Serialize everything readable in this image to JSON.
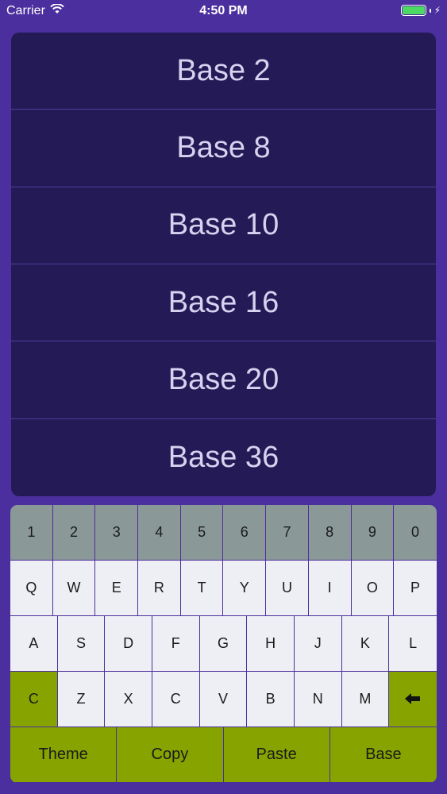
{
  "status_bar": {
    "carrier": "Carrier",
    "time": "4:50 PM",
    "wifi_icon": "wifi-icon",
    "battery_icon": "battery-icon",
    "charging_icon": "charging-bolt-icon"
  },
  "bases": [
    {
      "label": "Base 2"
    },
    {
      "label": "Base 8"
    },
    {
      "label": "Base 10"
    },
    {
      "label": "Base 16"
    },
    {
      "label": "Base 20"
    },
    {
      "label": "Base 36"
    }
  ],
  "keyboard": {
    "number_row": [
      "1",
      "2",
      "3",
      "4",
      "5",
      "6",
      "7",
      "8",
      "9",
      "0"
    ],
    "row_qwerty": [
      "Q",
      "W",
      "E",
      "R",
      "T",
      "Y",
      "U",
      "I",
      "O",
      "P"
    ],
    "row_asdf": [
      "A",
      "S",
      "D",
      "F",
      "G",
      "H",
      "J",
      "K",
      "L"
    ],
    "row_zxcv": {
      "clear": "C",
      "letters": [
        "Z",
        "X",
        "C",
        "V",
        "B",
        "N",
        "M"
      ],
      "backspace_icon": "backspace-arrow-icon"
    },
    "function_row": [
      "Theme",
      "Copy",
      "Paste",
      "Base"
    ]
  },
  "colors": {
    "background": "#4c2f9e",
    "list_background": "#241a56",
    "number_key": "#8b9898",
    "letter_key": "#eeeff4",
    "accent_key": "#86a300"
  }
}
